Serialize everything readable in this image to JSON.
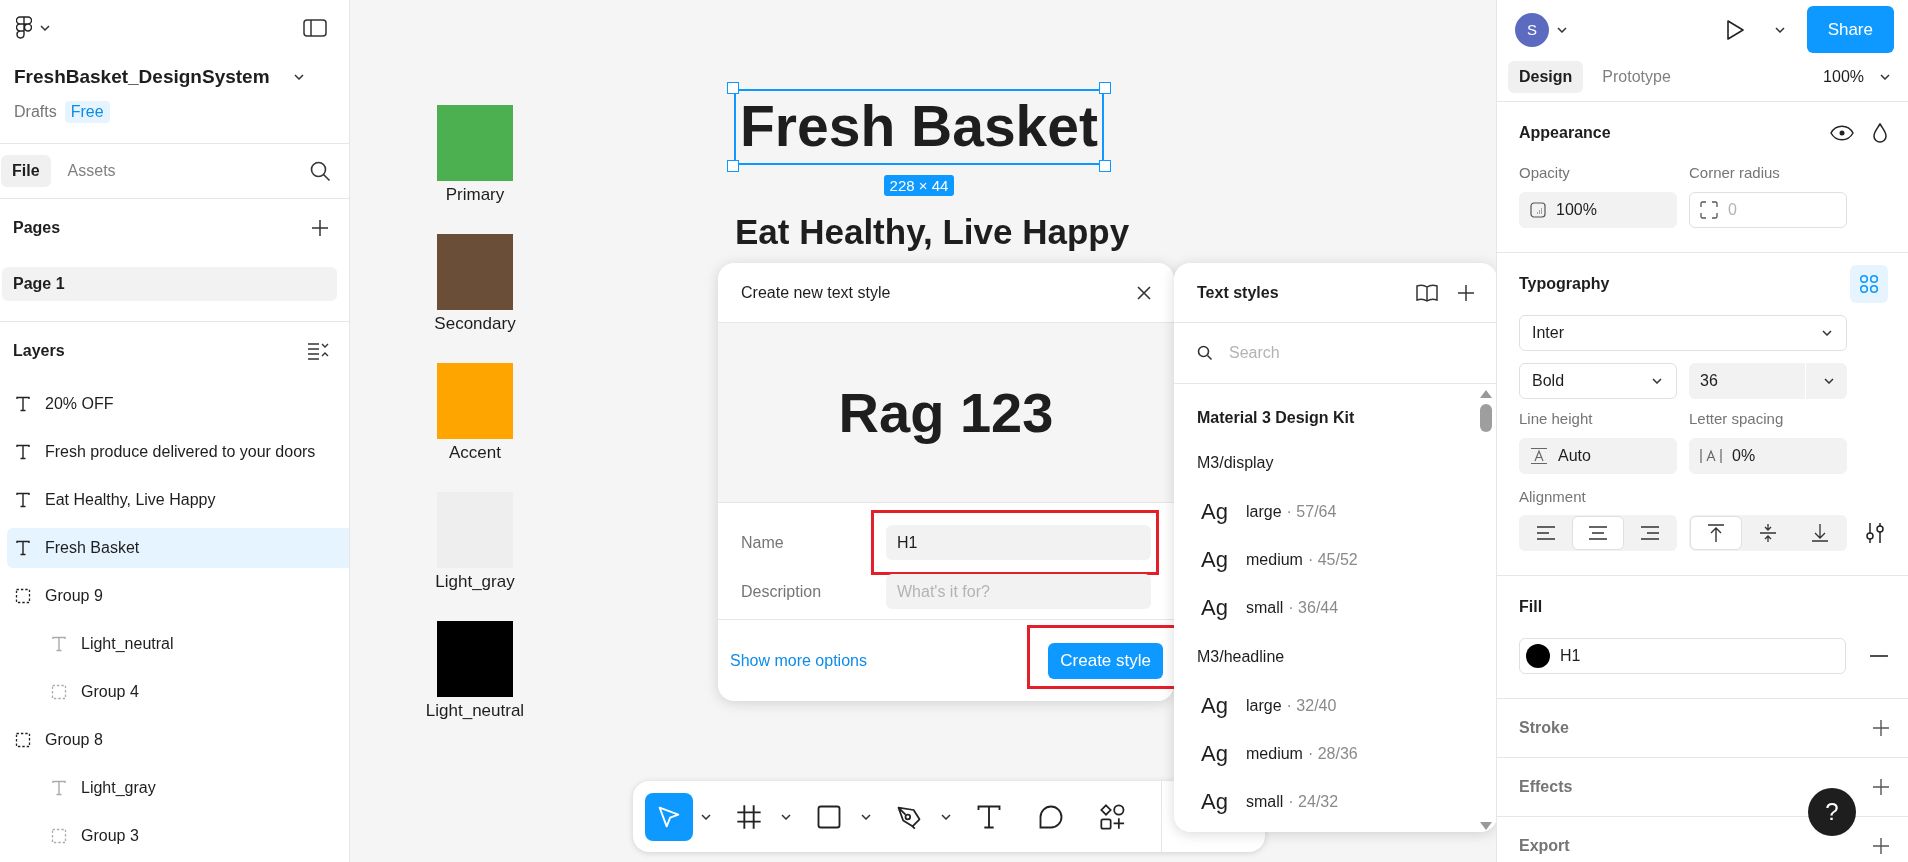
{
  "file": {
    "name": "FreshBasket_DesignSystem",
    "location": "Drafts",
    "plan": "Free"
  },
  "left_tabs": [
    {
      "label": "File",
      "selected": true
    },
    {
      "label": "Assets",
      "selected": false
    }
  ],
  "pages": {
    "title": "Pages",
    "items": [
      {
        "label": "Page 1",
        "selected": true
      }
    ]
  },
  "layers": {
    "title": "Layers",
    "items": [
      {
        "kind": "text",
        "label": "20% OFF",
        "selected": false
      },
      {
        "kind": "text",
        "label": "Fresh produce delivered to your doors",
        "selected": false
      },
      {
        "kind": "text",
        "label": "Eat Healthy, Live Happy",
        "selected": false
      },
      {
        "kind": "text",
        "label": "Fresh Basket",
        "selected": true
      },
      {
        "kind": "group",
        "label": "Group 9",
        "selected": false,
        "children": [
          {
            "kind": "text",
            "label": "Light_neutral",
            "selected": false
          },
          {
            "kind": "group",
            "label": "Group 4",
            "selected": false
          }
        ]
      },
      {
        "kind": "group",
        "label": "Group 8",
        "selected": false,
        "children": [
          {
            "kind": "text",
            "label": "Light_gray",
            "selected": false
          },
          {
            "kind": "group",
            "label": "Group 3",
            "selected": false
          }
        ]
      }
    ]
  },
  "canvas": {
    "swatches": [
      {
        "name": "Primary",
        "color": "#4caf50"
      },
      {
        "name": "Secondary",
        "color": "#6b4e37"
      },
      {
        "name": "Accent",
        "color": "#ffa500"
      },
      {
        "name": "Light_gray",
        "color": "#eeeeee"
      },
      {
        "name": "Light_neutral",
        "color": "#000000"
      }
    ],
    "title": {
      "text": "Fresh Basket",
      "selected": true,
      "size_label": "228 × 44"
    },
    "subtitle": "Eat Healthy, Live Happy"
  },
  "dialog": {
    "title": "Create new text style",
    "preview": "Rag 123",
    "fields": [
      {
        "label": "Name",
        "value": "H1",
        "highlighted": true
      },
      {
        "label": "Description",
        "placeholder": "What's it for?"
      }
    ],
    "link": "Show more options",
    "button": {
      "label": "Create style",
      "highlighted": true
    }
  },
  "text_styles": {
    "title": "Text styles",
    "search": {
      "placeholder": "Search"
    },
    "library": "Material 3 Design Kit",
    "groups": [
      {
        "name": "M3/display",
        "styles": [
          {
            "sample": "Ag",
            "name": "large",
            "detail": "· 57/64"
          },
          {
            "sample": "Ag",
            "name": "medium",
            "detail": "· 45/52"
          },
          {
            "sample": "Ag",
            "name": "small",
            "detail": "· 36/44"
          }
        ]
      },
      {
        "name": "M3/headline",
        "styles": [
          {
            "sample": "Ag",
            "name": "large",
            "detail": "· 32/40"
          },
          {
            "sample": "Ag",
            "name": "medium",
            "detail": "· 28/36"
          },
          {
            "sample": "Ag",
            "name": "small",
            "detail": "· 24/32"
          }
        ]
      }
    ]
  },
  "toolbar": [
    {
      "kind": "move",
      "selected": true,
      "menu": true
    },
    {
      "kind": "frame",
      "selected": false,
      "menu": true
    },
    {
      "kind": "rectangle",
      "selected": false,
      "menu": true
    },
    {
      "kind": "pen",
      "selected": false,
      "menu": true
    },
    {
      "kind": "text",
      "selected": false,
      "menu": false
    },
    {
      "kind": "comment",
      "selected": false,
      "menu": false
    },
    {
      "kind": "actions",
      "selected": false,
      "menu": false
    }
  ],
  "header": {
    "avatar": "S",
    "share": "Share"
  },
  "right_tabs": [
    {
      "label": "Design",
      "selected": true
    },
    {
      "label": "Prototype",
      "selected": false
    }
  ],
  "zoom": "100%",
  "appearance": {
    "title": "Appearance",
    "opacity_label": "Opacity",
    "opacity": "100%",
    "radius_label": "Corner radius",
    "radius": "0"
  },
  "typography": {
    "title": "Typography",
    "font": "Inter",
    "weight": "Bold",
    "size": "36",
    "line_height_label": "Line height",
    "line_height": "Auto",
    "letter_spacing_label": "Letter spacing",
    "letter_spacing": "0%",
    "alignment_label": "Alignment",
    "h_align": [
      {
        "kind": "left",
        "selected": false
      },
      {
        "kind": "center",
        "selected": true
      },
      {
        "kind": "right",
        "selected": false
      }
    ],
    "v_align": [
      {
        "kind": "top",
        "selected": true
      },
      {
        "kind": "middle",
        "selected": false
      },
      {
        "kind": "bottom",
        "selected": false
      }
    ]
  },
  "fill": {
    "title": "Fill",
    "style": "H1",
    "color": "#000000"
  },
  "sections": [
    "Stroke",
    "Effects",
    "Export"
  ],
  "help": "?"
}
